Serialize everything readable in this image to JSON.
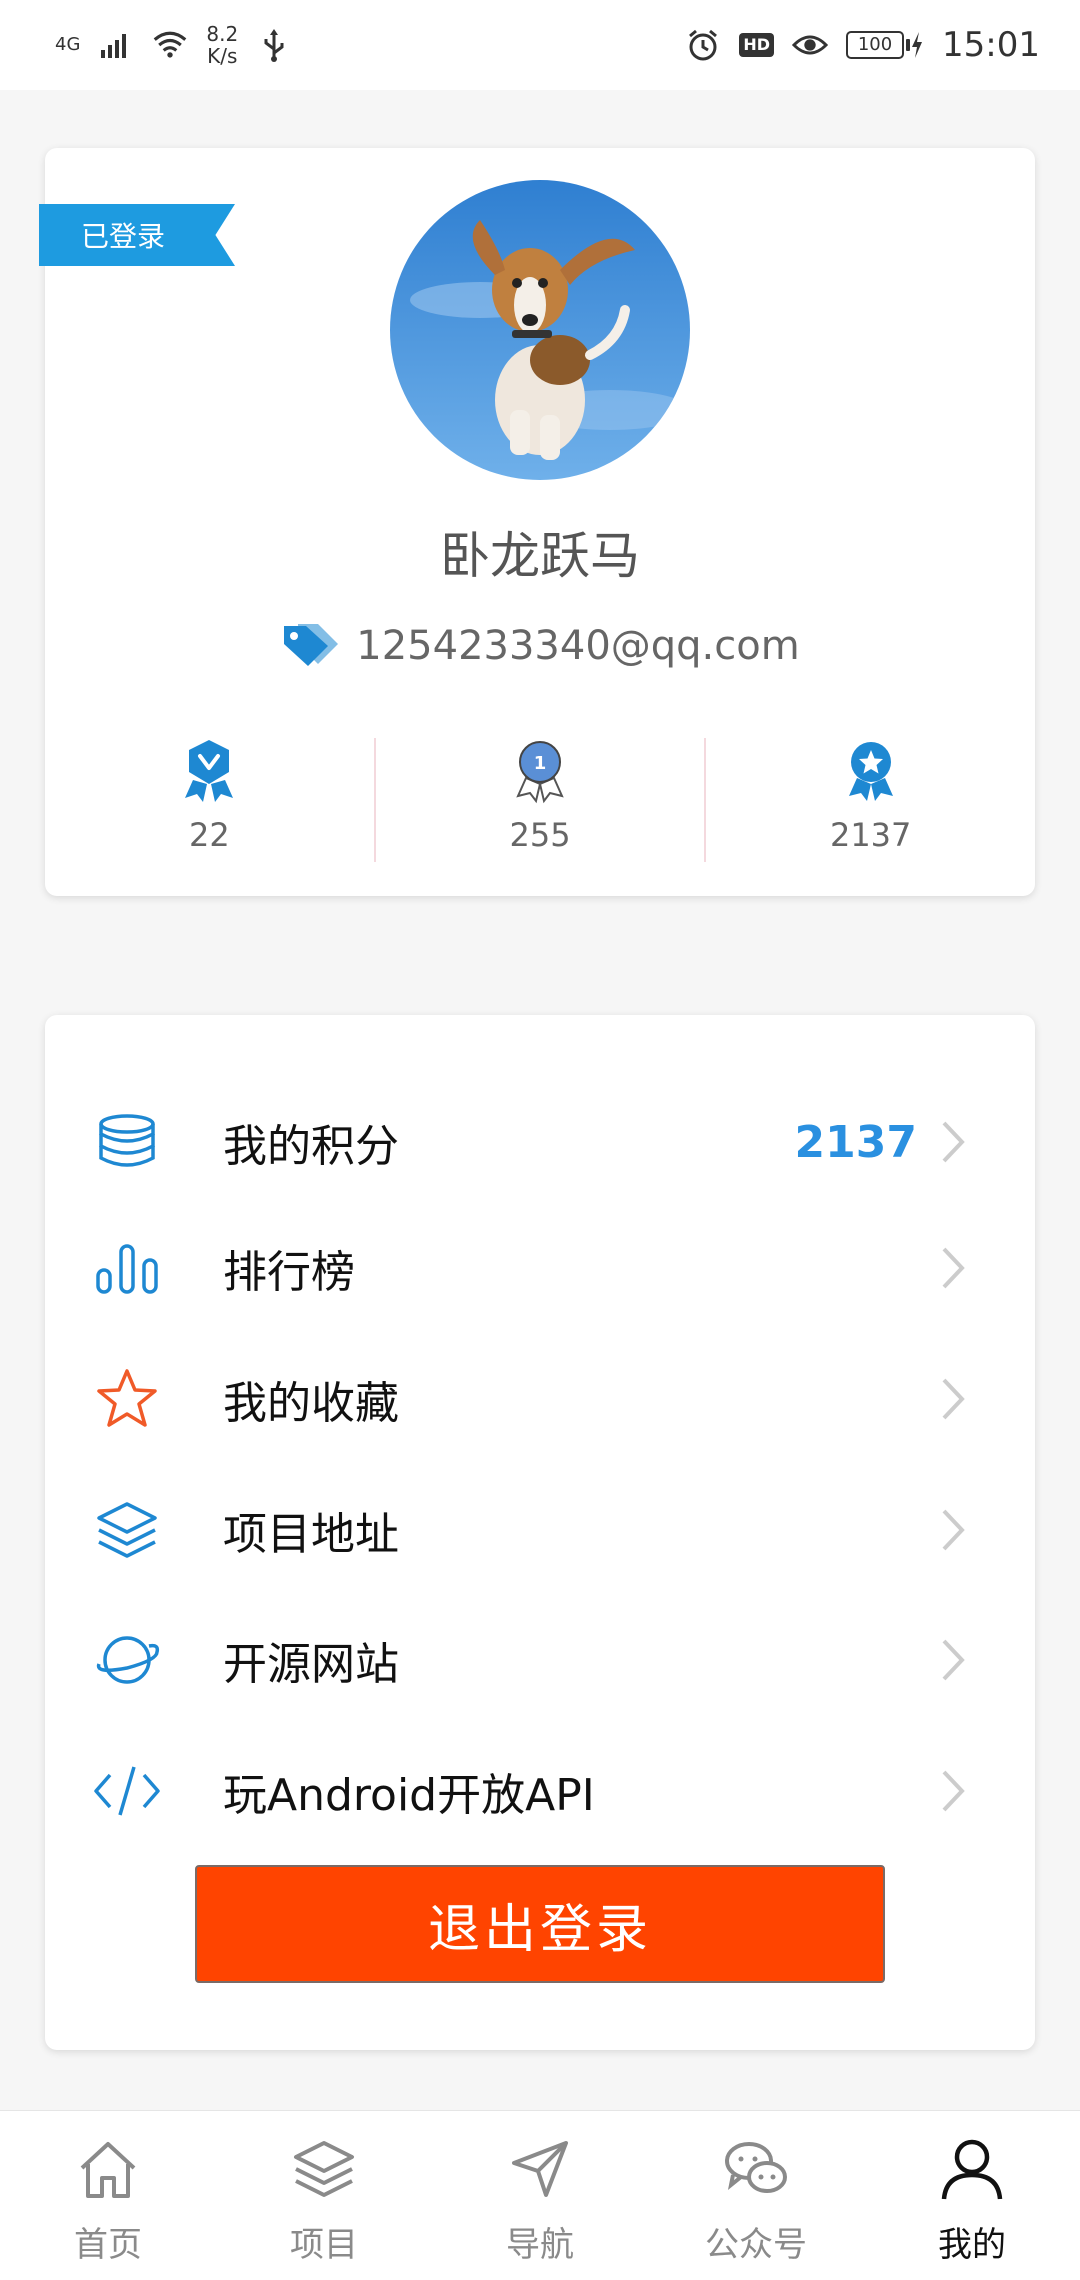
{
  "status_bar": {
    "network": "4G",
    "speed_value": "8.2",
    "speed_unit": "K/s",
    "hd": "HD",
    "battery": "100",
    "time": "15:01"
  },
  "profile": {
    "ribbon": "已登录",
    "username": "卧龙跃马",
    "email": "1254233340@qq.com",
    "stats": [
      {
        "icon": "level-badge-icon",
        "value": "22"
      },
      {
        "icon": "rank-medal-icon",
        "value": "255"
      },
      {
        "icon": "star-badge-icon",
        "value": "2137"
      }
    ]
  },
  "menu": {
    "items": [
      {
        "icon": "coins-stack-icon",
        "label": "我的积分",
        "value": "2137"
      },
      {
        "icon": "bar-chart-icon",
        "label": "排行榜",
        "value": ""
      },
      {
        "icon": "star-icon",
        "label": "我的收藏",
        "value": ""
      },
      {
        "icon": "layers-icon",
        "label": "项目地址",
        "value": ""
      },
      {
        "icon": "planet-icon",
        "label": "开源网站",
        "value": ""
      },
      {
        "icon": "code-icon",
        "label": "玩Android开放API",
        "value": ""
      }
    ],
    "logout_label": "退出登录"
  },
  "bottom_nav": {
    "items": [
      {
        "icon": "home-icon",
        "label": "首页"
      },
      {
        "icon": "layers-icon",
        "label": "项目"
      },
      {
        "icon": "navigation-arrow-icon",
        "label": "导航"
      },
      {
        "icon": "wechat-icon",
        "label": "公众号"
      },
      {
        "icon": "user-icon",
        "label": "我的"
      }
    ],
    "active": "我的"
  },
  "colors": {
    "accent": "#1e9be0",
    "logout": "#ff4400",
    "points": "#2a90e0",
    "star": "#f05a28"
  }
}
